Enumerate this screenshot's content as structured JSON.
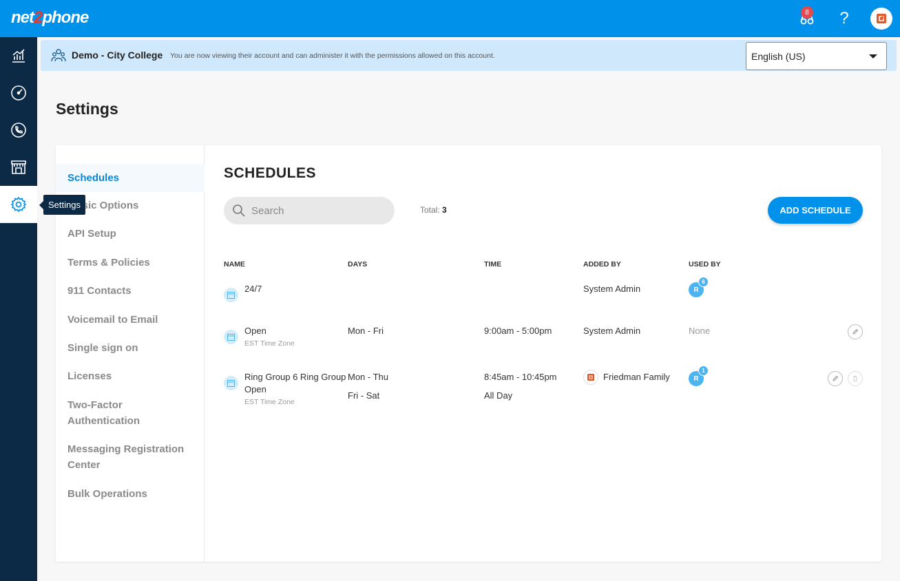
{
  "brand": {
    "logo_prefix": "net",
    "logo_two": "2",
    "logo_suffix": "phone",
    "accent": "#0091ea",
    "nav_bg": "#0c2a46"
  },
  "header": {
    "notification_count": "8",
    "help_label": "?"
  },
  "nav": {
    "tooltip": "Settings",
    "items": [
      "analytics-icon",
      "dashboard-icon",
      "calls-icon",
      "store-icon",
      "settings-icon"
    ]
  },
  "banner": {
    "account_name": "Demo - City College",
    "message": "You are now viewing their account and can administer it with the permissions allowed on this account.",
    "language": "English (US)"
  },
  "page": {
    "title": "Settings"
  },
  "subnav": {
    "items": [
      "Schedules",
      "Music Options",
      "API Setup",
      "Terms & Policies",
      "911 Contacts",
      "Voicemail to Email",
      "Single sign on",
      "Licenses",
      "Two-Factor Authentication",
      "Messaging Registration Center",
      "Bulk Operations"
    ]
  },
  "schedules": {
    "title": "SCHEDULES",
    "search_placeholder": "Search",
    "total_label": "Total:",
    "total_value": "3",
    "add_button": "ADD SCHEDULE",
    "columns": {
      "name": "NAME",
      "days": "DAYS",
      "time": "TIME",
      "added_by": "ADDED BY",
      "used_by": "USED BY"
    },
    "rows": [
      {
        "name": "24/7",
        "timezone": "",
        "days": [],
        "times": [],
        "added_by": "System Admin",
        "used_by_initial": "R",
        "used_by_count": "6"
      },
      {
        "name": "Open",
        "timezone": "EST Time Zone",
        "days": [
          "Mon - Fri"
        ],
        "times": [
          "9:00am - 5:00pm"
        ],
        "added_by": "System Admin",
        "used_by_none": "None"
      },
      {
        "name": "Ring Group 6 Ring Group Open",
        "name_line1": "Ring Group 6 Ring Group",
        "name_line2": "Open",
        "timezone": "EST Time Zone",
        "days": [
          "Mon - Thu",
          "Fri - Sat"
        ],
        "times": [
          "8:45am - 10:45pm",
          "All Day"
        ],
        "added_by": "Friedman Family",
        "used_by_initial": "R",
        "used_by_count": "1"
      }
    ]
  }
}
